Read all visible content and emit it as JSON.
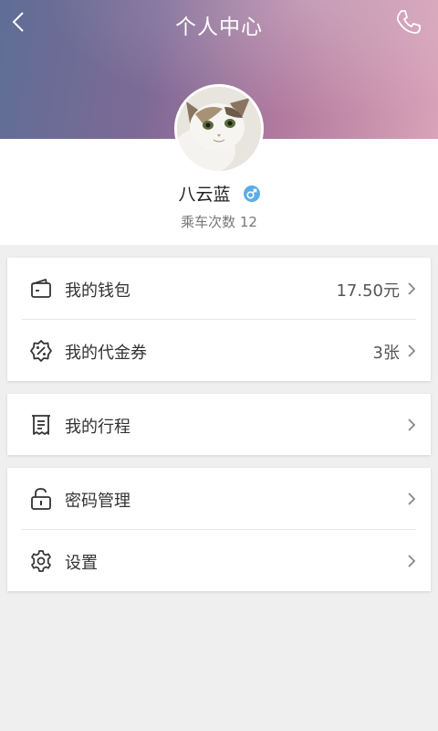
{
  "header": {
    "title": "个人中心",
    "back_icon": "chevron-left-icon",
    "call_icon": "phone-icon",
    "gradient_colors": [
      "#5e6e96",
      "#b17a9e",
      "#d9a3b8"
    ]
  },
  "profile": {
    "avatar": "cat-photo-avatar",
    "name": "八云蓝",
    "gender_icon": "male-icon",
    "gender_color": "#5aaee6",
    "rides_text": "乘车次数 12"
  },
  "menu": {
    "wallet": {
      "label": "我的钱包",
      "value": "17.50元",
      "icon": "wallet-icon"
    },
    "voucher": {
      "label": "我的代金券",
      "value": "3张",
      "icon": "discount-coupon-icon"
    },
    "trips": {
      "label": "我的行程",
      "icon": "receipt-icon"
    },
    "password": {
      "label": "密码管理",
      "icon": "unlock-icon"
    },
    "settings": {
      "label": "设置",
      "icon": "gear-icon"
    }
  }
}
